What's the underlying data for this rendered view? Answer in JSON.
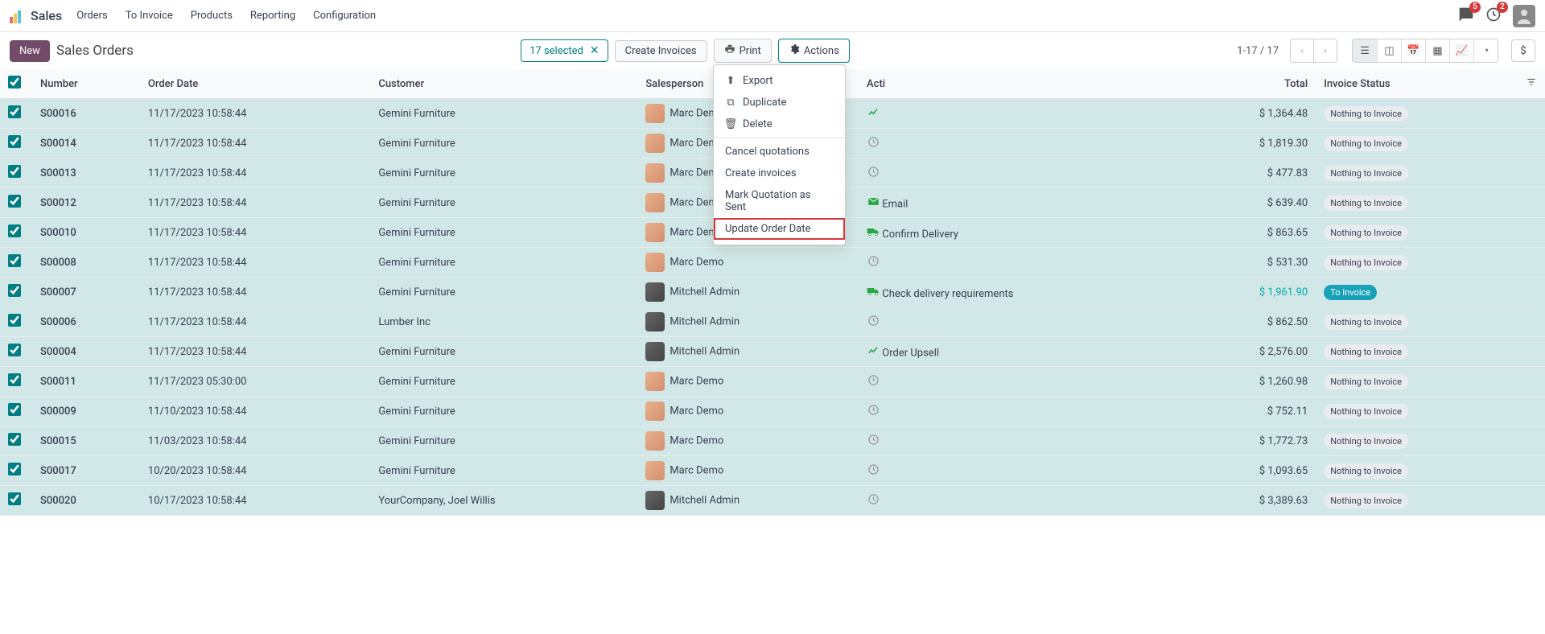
{
  "nav": {
    "brand": "Sales",
    "links": [
      "Orders",
      "To Invoice",
      "Products",
      "Reporting",
      "Configuration"
    ],
    "chat_badge": "5",
    "clock_badge": "2"
  },
  "control": {
    "new_label": "New",
    "title": "Sales Orders",
    "selected_text": "17 selected",
    "create_invoices": "Create Invoices",
    "print": "Print",
    "actions": "Actions",
    "pager": "1-17 / 17"
  },
  "dropdown": {
    "export": "Export",
    "duplicate": "Duplicate",
    "delete": "Delete",
    "cancel_q": "Cancel quotations",
    "create_inv": "Create invoices",
    "mark_sent": "Mark Quotation as Sent",
    "update_date": "Update Order Date"
  },
  "headers": {
    "number": "Number",
    "order_date": "Order Date",
    "customer": "Customer",
    "salesperson": "Salesperson",
    "activities": "Acti",
    "total": "Total",
    "invoice_status": "Invoice Status"
  },
  "rows": [
    {
      "num": "S00016",
      "date": "11/17/2023 10:58:44",
      "cust": "Gemini Furniture",
      "sp": "Marc Demo",
      "av": "marc",
      "act": "chart",
      "act_c": "ico-green",
      "act_t": "",
      "total": "$ 1,364.48",
      "inv": "Nothing to Invoice",
      "inv_c": ""
    },
    {
      "num": "S00014",
      "date": "11/17/2023 10:58:44",
      "cust": "Gemini Furniture",
      "sp": "Marc Demo",
      "av": "marc",
      "act": "clock",
      "act_c": "ico-grey",
      "act_t": "",
      "total": "$ 1,819.30",
      "inv": "Nothing to Invoice",
      "inv_c": ""
    },
    {
      "num": "S00013",
      "date": "11/17/2023 10:58:44",
      "cust": "Gemini Furniture",
      "sp": "Marc Demo",
      "av": "marc",
      "act": "clock",
      "act_c": "ico-grey",
      "act_t": "",
      "total": "$ 477.83",
      "inv": "Nothing to Invoice",
      "inv_c": ""
    },
    {
      "num": "S00012",
      "date": "11/17/2023 10:58:44",
      "cust": "Gemini Furniture",
      "sp": "Marc Demo",
      "av": "marc",
      "act": "mail",
      "act_c": "ico-green",
      "act_t": "Email",
      "total": "$ 639.40",
      "inv": "Nothing to Invoice",
      "inv_c": ""
    },
    {
      "num": "S00010",
      "date": "11/17/2023 10:58:44",
      "cust": "Gemini Furniture",
      "sp": "Marc Demo",
      "av": "marc",
      "act": "truck",
      "act_c": "ico-green",
      "act_t": "Confirm Delivery",
      "total": "$ 863.65",
      "inv": "Nothing to Invoice",
      "inv_c": ""
    },
    {
      "num": "S00008",
      "date": "11/17/2023 10:58:44",
      "cust": "Gemini Furniture",
      "sp": "Marc Demo",
      "av": "marc",
      "act": "clock",
      "act_c": "ico-grey",
      "act_t": "",
      "total": "$ 531.30",
      "inv": "Nothing to Invoice",
      "inv_c": ""
    },
    {
      "num": "S00007",
      "date": "11/17/2023 10:58:44",
      "cust": "Gemini Furniture",
      "sp": "Mitchell Admin",
      "av": "mitch",
      "act": "truck",
      "act_c": "ico-green",
      "act_t": "Check delivery requirements",
      "total": "$ 1,961.90",
      "total_c": "teal",
      "inv": "To Invoice",
      "inv_c": "toinv"
    },
    {
      "num": "S00006",
      "date": "11/17/2023 10:58:44",
      "cust": "Lumber Inc",
      "sp": "Mitchell Admin",
      "av": "mitch",
      "act": "clock",
      "act_c": "ico-grey",
      "act_t": "",
      "total": "$ 862.50",
      "inv": "Nothing to Invoice",
      "inv_c": ""
    },
    {
      "num": "S00004",
      "date": "11/17/2023 10:58:44",
      "cust": "Gemini Furniture",
      "sp": "Mitchell Admin",
      "av": "mitch",
      "act": "chart",
      "act_c": "ico-green",
      "act_t": "Order Upsell",
      "total": "$ 2,576.00",
      "inv": "Nothing to Invoice",
      "inv_c": ""
    },
    {
      "num": "S00011",
      "date": "11/17/2023 05:30:00",
      "cust": "Gemini Furniture",
      "sp": "Marc Demo",
      "av": "marc",
      "act": "clock",
      "act_c": "ico-grey",
      "act_t": "",
      "total": "$ 1,260.98",
      "inv": "Nothing to Invoice",
      "inv_c": ""
    },
    {
      "num": "S00009",
      "date": "11/10/2023 10:58:44",
      "cust": "Gemini Furniture",
      "sp": "Marc Demo",
      "av": "marc",
      "act": "clock",
      "act_c": "ico-grey",
      "act_t": "",
      "total": "$ 752.11",
      "inv": "Nothing to Invoice",
      "inv_c": ""
    },
    {
      "num": "S00015",
      "date": "11/03/2023 10:58:44",
      "cust": "Gemini Furniture",
      "sp": "Marc Demo",
      "av": "marc",
      "act": "clock",
      "act_c": "ico-grey",
      "act_t": "",
      "total": "$ 1,772.73",
      "inv": "Nothing to Invoice",
      "inv_c": ""
    },
    {
      "num": "S00017",
      "date": "10/20/2023 10:58:44",
      "cust": "Gemini Furniture",
      "sp": "Marc Demo",
      "av": "marc",
      "act": "clock",
      "act_c": "ico-grey",
      "act_t": "",
      "total": "$ 1,093.65",
      "inv": "Nothing to Invoice",
      "inv_c": ""
    },
    {
      "num": "S00020",
      "date": "10/17/2023 10:58:44",
      "cust": "YourCompany, Joel Willis",
      "sp": "Mitchell Admin",
      "av": "mitch",
      "act": "clock",
      "act_c": "ico-grey",
      "act_t": "",
      "total": "$ 3,389.63",
      "inv": "Nothing to Invoice",
      "inv_c": ""
    }
  ],
  "icons": {
    "clock": "◔",
    "chart": "▞",
    "mail": "✉",
    "truck": "⛟"
  }
}
